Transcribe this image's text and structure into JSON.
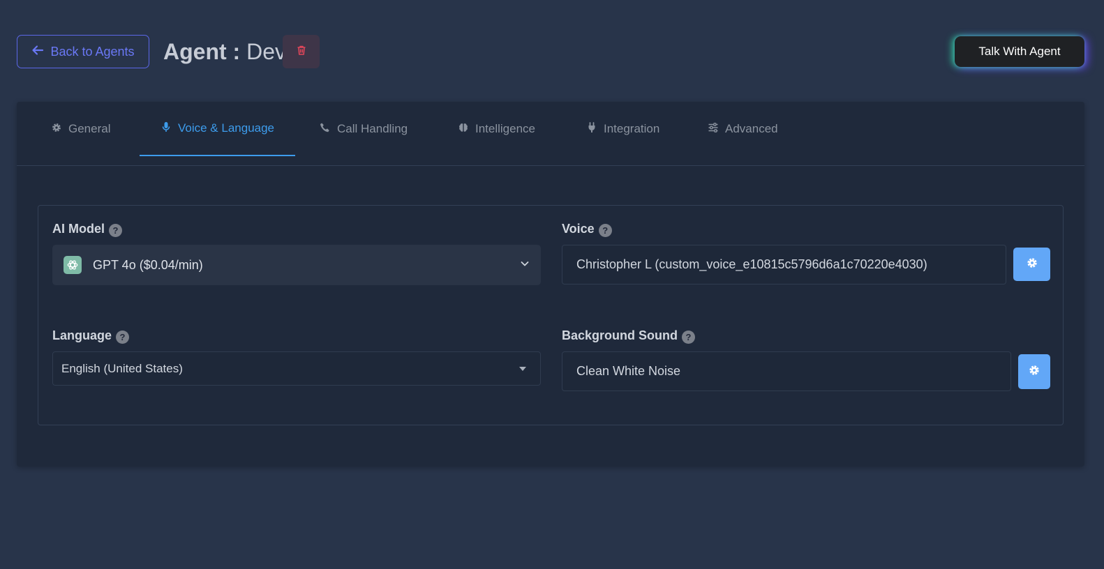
{
  "header": {
    "back_label": "Back to Agents",
    "title_prefix": "Agent : ",
    "agent_name": "Dev",
    "talk_label": "Talk With Agent"
  },
  "tabs": [
    {
      "label": "General",
      "icon": "gear-icon",
      "active": false
    },
    {
      "label": "Voice & Language",
      "icon": "microphone-icon",
      "active": true
    },
    {
      "label": "Call Handling",
      "icon": "phone-icon",
      "active": false
    },
    {
      "label": "Intelligence",
      "icon": "brain-icon",
      "active": false
    },
    {
      "label": "Integration",
      "icon": "plug-icon",
      "active": false
    },
    {
      "label": "Advanced",
      "icon": "sliders-icon",
      "active": false
    }
  ],
  "fields": {
    "ai_model": {
      "label": "AI Model",
      "value": "GPT 4o ($0.04/min)",
      "help": "?"
    },
    "voice": {
      "label": "Voice",
      "value": "Christopher L (custom_voice_e10815c5796d6a1c70220e4030)",
      "help": "?"
    },
    "language": {
      "label": "Language",
      "value": "English (United States)",
      "help": "?"
    },
    "background_sound": {
      "label": "Background Sound",
      "value": "Clean White Noise",
      "help": "?"
    }
  },
  "colors": {
    "page_bg": "#28344a",
    "card_bg": "#1f293b",
    "accent_tab": "#3d9cec",
    "back_button": "#5b67e8",
    "delete_icon": "#e0465a",
    "gear_button": "#62a7f7",
    "openai_logo_bg": "#7fbba7"
  }
}
